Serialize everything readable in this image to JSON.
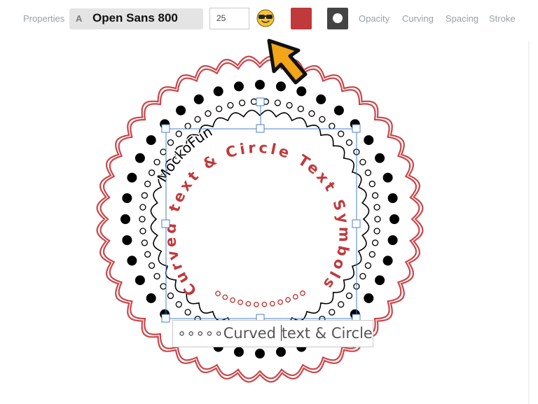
{
  "toolbar": {
    "properties_label": "Properties",
    "font_icon": "A",
    "font_name": "Open Sans 800",
    "font_size": "25",
    "emoji_icon": "sunglasses-smiley-icon",
    "text_color": "#c0393b",
    "outline_color": "#444444",
    "opacity_label": "Opacity",
    "curving_label": "Curving",
    "spacing_label": "Spacing",
    "stroke_label": "Stroke"
  },
  "canvas": {
    "curved_text": "Curved text & Circle Text Symbols",
    "brand_text": "MockoFun",
    "text_color": "#c0393b",
    "ring_color": "#c9464a"
  },
  "editor": {
    "input_before_caret": "∘∘∘∘∘Curved ",
    "input_after_caret": "text & Circle T"
  },
  "colors": {
    "accent_arrow": "#f2a516",
    "selection": "#4a7fd0"
  }
}
